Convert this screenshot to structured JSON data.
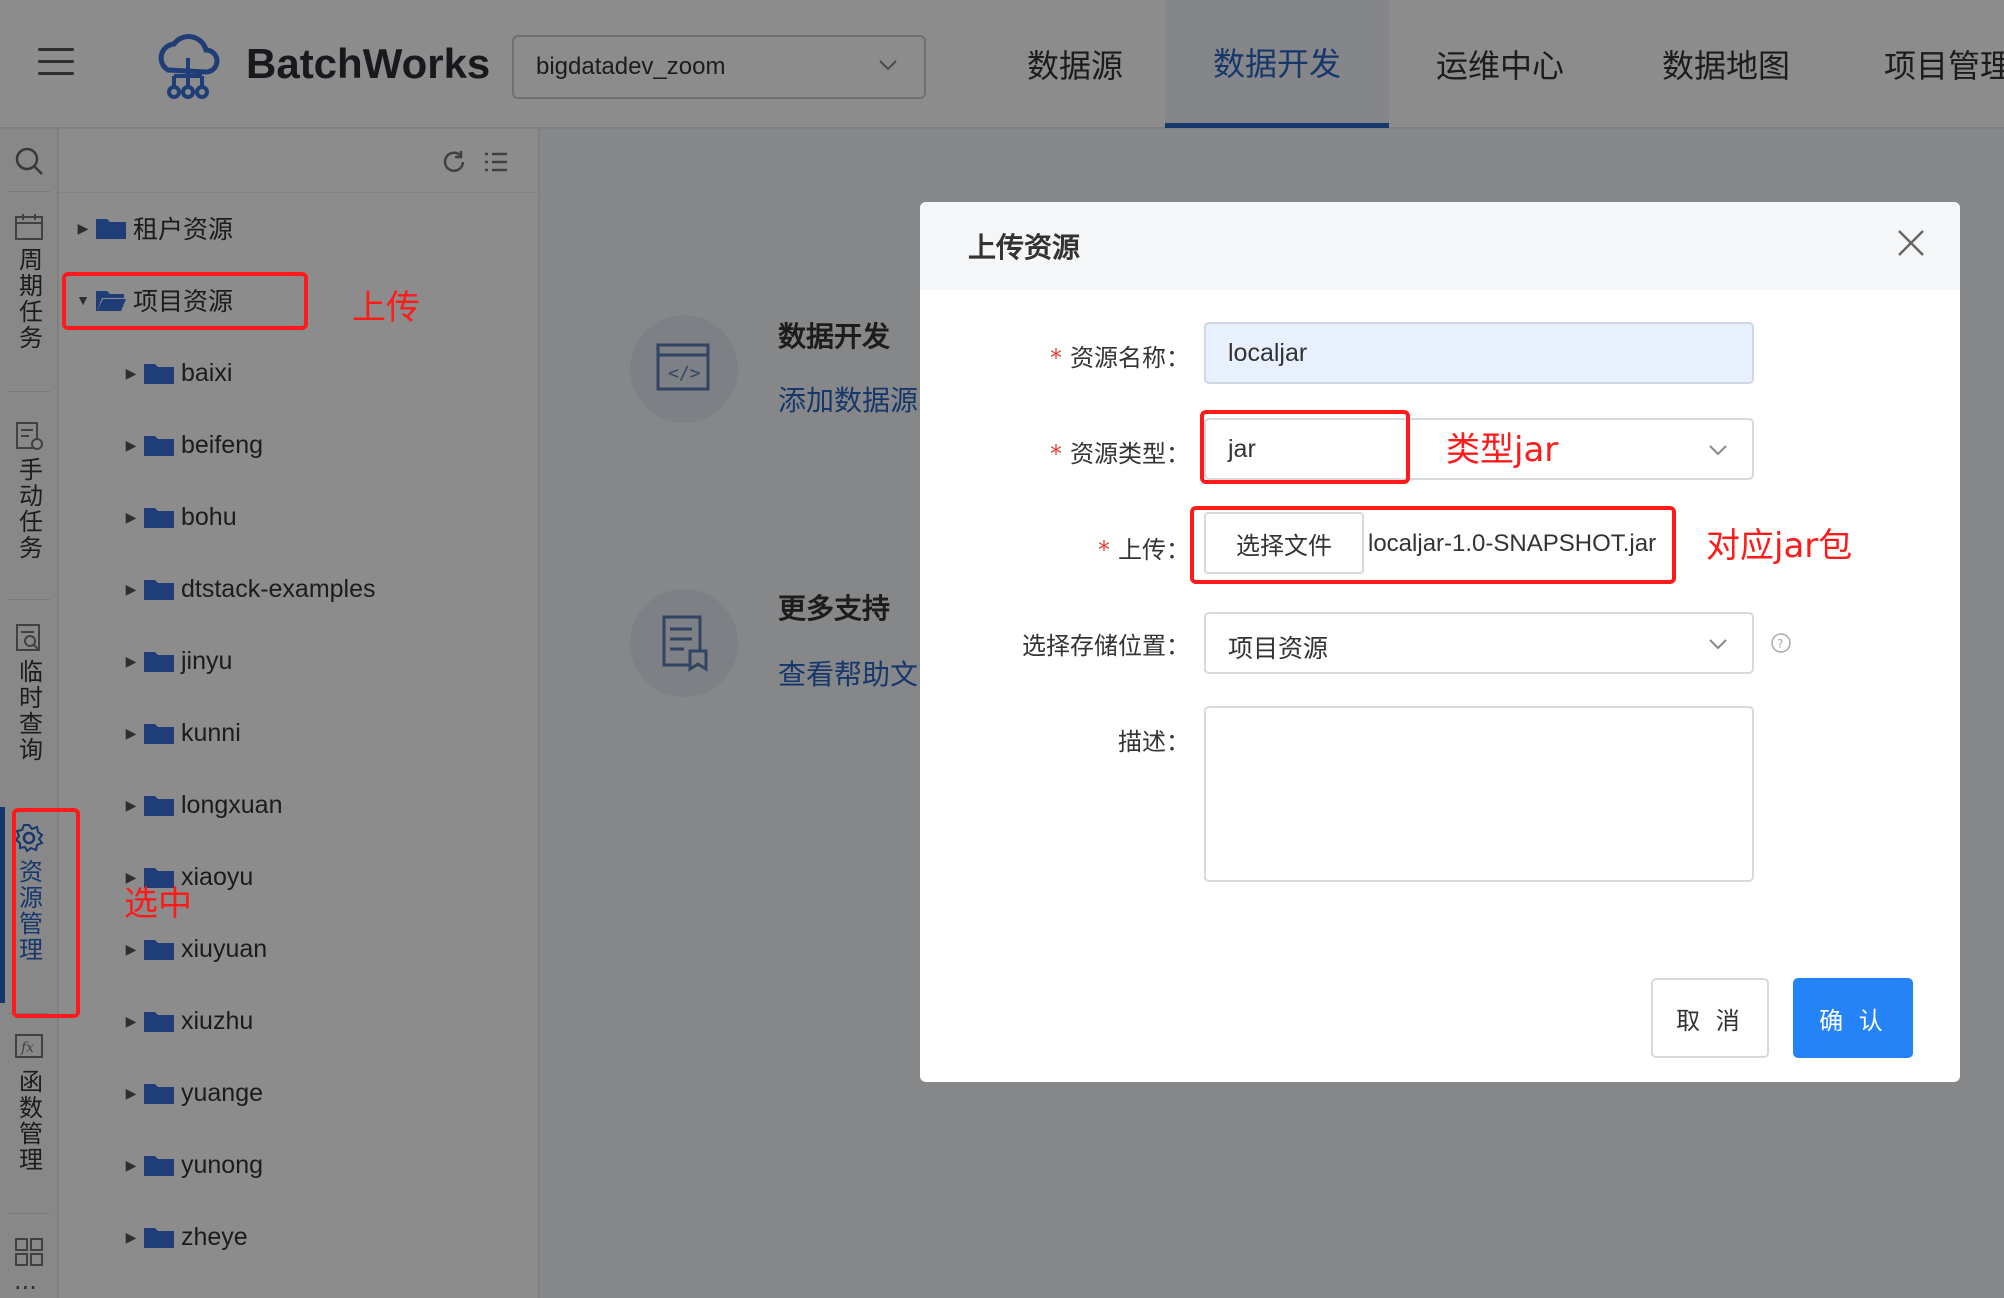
{
  "topbar": {
    "brand": "BatchWorks",
    "project_select": "bigdatadev_zoom",
    "nav": [
      "数据源",
      "数据开发",
      "运维中心",
      "数据地图",
      "项目管理"
    ],
    "active_nav": "数据开发",
    "accent": "#2a65c4"
  },
  "rail": {
    "items": [
      {
        "label": "周期任务",
        "icon": "calendar-icon"
      },
      {
        "label": "手动任务",
        "icon": "manual-task-icon"
      },
      {
        "label": "临时查询",
        "icon": "query-icon"
      },
      {
        "label": "资源管理",
        "icon": "gear-icon"
      },
      {
        "label": "函数管理",
        "icon": "function-icon"
      }
    ],
    "more": "...",
    "active": "资源管理"
  },
  "tree": {
    "root_items": [
      {
        "label": "租户资源",
        "expanded": false
      },
      {
        "label": "项目资源",
        "expanded": true
      }
    ],
    "children": [
      "baixi",
      "beifeng",
      "bohu",
      "dtstack-examples",
      "jinyu",
      "kunni",
      "longxuan",
      "xiaoyu",
      "xiuyuan",
      "xiuzhu",
      "yuange",
      "yunong",
      "zheye"
    ]
  },
  "main": {
    "card1": {
      "title": "数据开发",
      "link": "添加数据源"
    },
    "card2": {
      "title": "更多支持",
      "link": "查看帮助文"
    }
  },
  "modal": {
    "title": "上传资源",
    "fields": {
      "name_label": "资源名称：",
      "name_value": "localjar",
      "type_label": "资源类型：",
      "type_value": "jar",
      "upload_label": "上传：",
      "file_button": "选择文件",
      "file_name": "localjar-1.0-SNAPSHOT.jar",
      "location_label": "选择存储位置：",
      "location_value": "项目资源",
      "desc_label": "描述：",
      "desc_value": ""
    },
    "required_mark": "*",
    "cancel": "取 消",
    "confirm": "确 认"
  },
  "annotations": {
    "upload": "上传",
    "type_jar": "类型jar",
    "jar_pkg": "对应jar包",
    "selected": "选中",
    "color": "#ff1a1a"
  }
}
